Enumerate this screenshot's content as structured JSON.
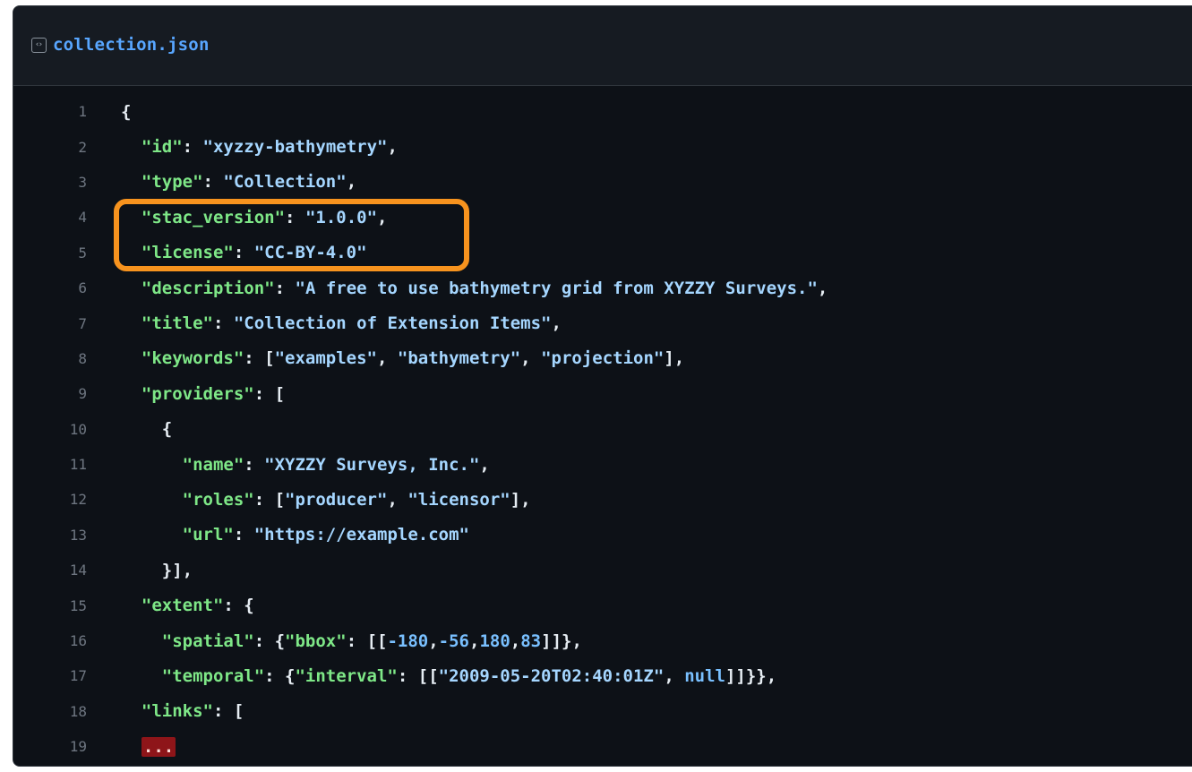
{
  "file": {
    "name": "collection.json",
    "icon": "code-file-icon",
    "icon_glyph": "‹›"
  },
  "code_lines": [
    {
      "n": "1",
      "t": [
        [
          "p",
          "{"
        ]
      ]
    },
    {
      "n": "2",
      "t": [
        [
          "p",
          "  "
        ],
        [
          "k",
          "\"id\""
        ],
        [
          "p",
          ": "
        ],
        [
          "s",
          "\"xyzzy-bathymetry\""
        ],
        [
          "p",
          ","
        ]
      ]
    },
    {
      "n": "3",
      "t": [
        [
          "p",
          "  "
        ],
        [
          "k",
          "\"type\""
        ],
        [
          "p",
          ": "
        ],
        [
          "s",
          "\"Collection\""
        ],
        [
          "p",
          ","
        ]
      ]
    },
    {
      "n": "4",
      "t": [
        [
          "p",
          "  "
        ],
        [
          "k",
          "\"stac_version\""
        ],
        [
          "p",
          ": "
        ],
        [
          "s",
          "\"1.0.0\""
        ],
        [
          "p",
          ","
        ]
      ]
    },
    {
      "n": "5",
      "t": [
        [
          "p",
          "  "
        ],
        [
          "k",
          "\"license\""
        ],
        [
          "p",
          ": "
        ],
        [
          "s",
          "\"CC-BY-4.0\""
        ]
      ]
    },
    {
      "n": "6",
      "t": [
        [
          "p",
          "  "
        ],
        [
          "k",
          "\"description\""
        ],
        [
          "p",
          ": "
        ],
        [
          "s",
          "\"A free to use bathymetry grid from XYZZY Surveys.\""
        ],
        [
          "p",
          ","
        ]
      ]
    },
    {
      "n": "7",
      "t": [
        [
          "p",
          "  "
        ],
        [
          "k",
          "\"title\""
        ],
        [
          "p",
          ": "
        ],
        [
          "s",
          "\"Collection of Extension Items\""
        ],
        [
          "p",
          ","
        ]
      ]
    },
    {
      "n": "8",
      "t": [
        [
          "p",
          "  "
        ],
        [
          "k",
          "\"keywords\""
        ],
        [
          "p",
          ": ["
        ],
        [
          "s",
          "\"examples\""
        ],
        [
          "p",
          ", "
        ],
        [
          "s",
          "\"bathymetry\""
        ],
        [
          "p",
          ", "
        ],
        [
          "s",
          "\"projection\""
        ],
        [
          "p",
          "],"
        ]
      ]
    },
    {
      "n": "9",
      "t": [
        [
          "p",
          "  "
        ],
        [
          "k",
          "\"providers\""
        ],
        [
          "p",
          ": ["
        ]
      ]
    },
    {
      "n": "10",
      "t": [
        [
          "p",
          "    {"
        ]
      ]
    },
    {
      "n": "11",
      "t": [
        [
          "p",
          "      "
        ],
        [
          "k",
          "\"name\""
        ],
        [
          "p",
          ": "
        ],
        [
          "s",
          "\"XYZZY Surveys, Inc.\""
        ],
        [
          "p",
          ","
        ]
      ]
    },
    {
      "n": "12",
      "t": [
        [
          "p",
          "      "
        ],
        [
          "k",
          "\"roles\""
        ],
        [
          "p",
          ": ["
        ],
        [
          "s",
          "\"producer\""
        ],
        [
          "p",
          ", "
        ],
        [
          "s",
          "\"licensor\""
        ],
        [
          "p",
          "],"
        ]
      ]
    },
    {
      "n": "13",
      "t": [
        [
          "p",
          "      "
        ],
        [
          "k",
          "\"url\""
        ],
        [
          "p",
          ": "
        ],
        [
          "s",
          "\"https://example.com\""
        ]
      ]
    },
    {
      "n": "14",
      "t": [
        [
          "p",
          "    }],"
        ]
      ]
    },
    {
      "n": "15",
      "t": [
        [
          "p",
          "  "
        ],
        [
          "k",
          "\"extent\""
        ],
        [
          "p",
          ": {"
        ]
      ]
    },
    {
      "n": "16",
      "t": [
        [
          "p",
          "    "
        ],
        [
          "k",
          "\"spatial\""
        ],
        [
          "p",
          ": {"
        ],
        [
          "k",
          "\"bbox\""
        ],
        [
          "p",
          ": [["
        ],
        [
          "n",
          "-180"
        ],
        [
          "p",
          ","
        ],
        [
          "n",
          "-56"
        ],
        [
          "p",
          ","
        ],
        [
          "n",
          "180"
        ],
        [
          "p",
          ","
        ],
        [
          "n",
          "83"
        ],
        [
          "p",
          "]]},"
        ]
      ]
    },
    {
      "n": "17",
      "t": [
        [
          "p",
          "    "
        ],
        [
          "k",
          "\"temporal\""
        ],
        [
          "p",
          ": {"
        ],
        [
          "k",
          "\"interval\""
        ],
        [
          "p",
          ": [["
        ],
        [
          "s",
          "\"2009-05-20T02:40:01Z\""
        ],
        [
          "p",
          ", "
        ],
        [
          "n",
          "null"
        ],
        [
          "p",
          "]]}},"
        ]
      ]
    },
    {
      "n": "18",
      "t": [
        [
          "p",
          "  "
        ],
        [
          "k",
          "\"links\""
        ],
        [
          "p",
          ": ["
        ]
      ]
    },
    {
      "n": "19",
      "t": [
        [
          "p",
          "  "
        ],
        [
          "e",
          "..."
        ]
      ]
    }
  ],
  "highlight": {
    "color": "#f7931e",
    "target_lines": [
      "4",
      "5"
    ]
  },
  "colors": {
    "background": "#0d1117",
    "header_bg": "#161b22",
    "key": "#7ee787",
    "string": "#a5d6ff",
    "number": "#79c0ff",
    "filename": "#58a6ff",
    "line_number": "#6e7681"
  }
}
